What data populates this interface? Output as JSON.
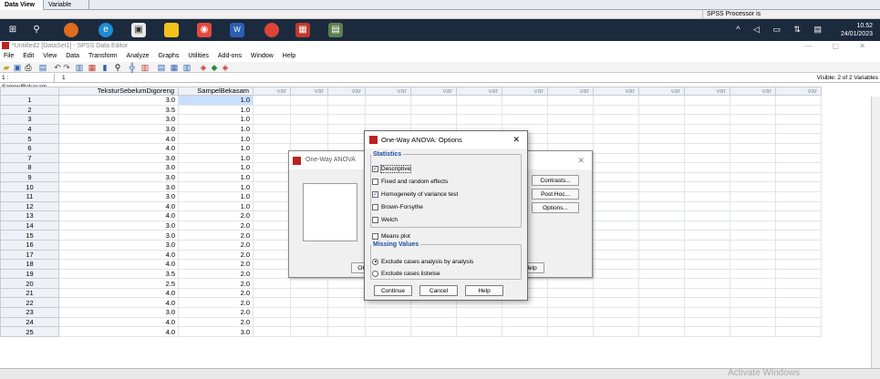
{
  "top_tabs": [
    "Data View",
    "Variable View"
  ],
  "status": {
    "processor": "SPSS  Processor is ready"
  },
  "taskbar": {
    "time": "10.52",
    "date": "24/01/2023"
  },
  "window": {
    "title": "*Untitled2 [DataSet1] - SPSS Data Editor"
  },
  "menu": [
    "File",
    "Edit",
    "View",
    "Data",
    "Transform",
    "Analyze",
    "Graphs",
    "Utilities",
    "Add-ons",
    "Window",
    "Help"
  ],
  "cell_ref": {
    "name": "1 : SampelBekasam",
    "value": "1"
  },
  "visible_label": "Visible: 2 of 2 Variables",
  "columns": [
    "TeksturSebelumDigoreng",
    "SampelBekasam",
    "var",
    "var",
    "var",
    "var",
    "var",
    "var",
    "var",
    "var",
    "var",
    "var",
    "var",
    "var",
    "var"
  ],
  "rows": [
    [
      "1",
      "3.0",
      "1.0"
    ],
    [
      "2",
      "3.5",
      "1.0"
    ],
    [
      "3",
      "3.0",
      "1.0"
    ],
    [
      "4",
      "3.0",
      "1.0"
    ],
    [
      "5",
      "4.0",
      "1.0"
    ],
    [
      "6",
      "4.0",
      "1.0"
    ],
    [
      "7",
      "3.0",
      "1.0"
    ],
    [
      "8",
      "3.0",
      "1.0"
    ],
    [
      "9",
      "3.0",
      "1.0"
    ],
    [
      "10",
      "3.0",
      "1.0"
    ],
    [
      "11",
      "3.0",
      "1.0"
    ],
    [
      "12",
      "4.0",
      "1.0"
    ],
    [
      "13",
      "4.0",
      "2.0"
    ],
    [
      "14",
      "3.0",
      "2.0"
    ],
    [
      "15",
      "3.0",
      "2.0"
    ],
    [
      "16",
      "3.0",
      "2.0"
    ],
    [
      "17",
      "4.0",
      "2.0"
    ],
    [
      "18",
      "4.0",
      "2.0"
    ],
    [
      "19",
      "3.5",
      "2.0"
    ],
    [
      "20",
      "2.5",
      "2.0"
    ],
    [
      "21",
      "4.0",
      "2.0"
    ],
    [
      "22",
      "4.0",
      "2.0"
    ],
    [
      "23",
      "3.0",
      "2.0"
    ],
    [
      "24",
      "4.0",
      "2.0"
    ],
    [
      "25",
      "4.0",
      "3.0"
    ]
  ],
  "watermark": "Activate Windows",
  "back_dialog": {
    "title": "One-Way ANOVA",
    "buttons": [
      "Contrasts...",
      "Post Hoc...",
      "Options...",
      "OK",
      "Help"
    ]
  },
  "options_dialog": {
    "title": "One-Way ANOVA: Options",
    "statistics_legend": "Statistics",
    "statistics": [
      {
        "label": "Descriptive",
        "checked": true
      },
      {
        "label": "Fixed and random effects",
        "checked": false
      },
      {
        "label": "Homogeneity of variance test",
        "checked": true
      },
      {
        "label": "Brown-Forsythe",
        "checked": false
      },
      {
        "label": "Welch",
        "checked": false
      }
    ],
    "means_plot": "Means plot",
    "missing_legend": "Missing Values",
    "missing": [
      {
        "label": "Exclude cases analysis by analysis",
        "selected": true
      },
      {
        "label": "Exclude cases listwise",
        "selected": false
      }
    ],
    "buttons": {
      "continue": "Continue",
      "cancel": "Cancel",
      "help": "Help"
    }
  }
}
